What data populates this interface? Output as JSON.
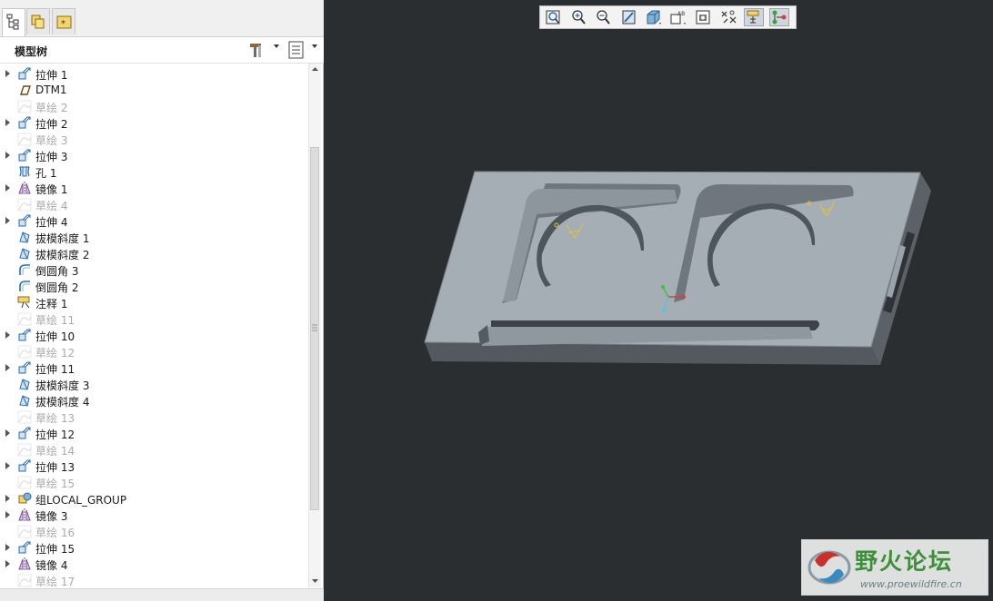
{
  "tabs": [
    {
      "icon": "model-tree-tab-icon"
    },
    {
      "icon": "folder-browser-tab-icon"
    },
    {
      "icon": "favorites-tab-icon"
    }
  ],
  "tree": {
    "title": "模型树",
    "header_buttons": [
      {
        "icon": "tree-settings-icon"
      },
      {
        "icon": "tree-columns-icon"
      }
    ],
    "items": [
      {
        "label": "拉伸 1",
        "icon": "extrude-icon",
        "expandable": true,
        "dim": false
      },
      {
        "label": "DTM1",
        "icon": "datum-plane-icon",
        "expandable": false,
        "dim": false
      },
      {
        "label": "草绘 2",
        "icon": "sketch-icon",
        "expandable": false,
        "dim": true
      },
      {
        "label": "拉伸 2",
        "icon": "extrude-icon",
        "expandable": true,
        "dim": false
      },
      {
        "label": "草绘 3",
        "icon": "sketch-icon",
        "expandable": false,
        "dim": true
      },
      {
        "label": "拉伸 3",
        "icon": "extrude-icon",
        "expandable": true,
        "dim": false
      },
      {
        "label": "孔 1",
        "icon": "hole-icon",
        "expandable": false,
        "dim": false
      },
      {
        "label": "镜像 1",
        "icon": "mirror-icon",
        "expandable": true,
        "dim": false
      },
      {
        "label": "草绘 4",
        "icon": "sketch-icon",
        "expandable": false,
        "dim": true
      },
      {
        "label": "拉伸 4",
        "icon": "extrude-icon",
        "expandable": true,
        "dim": false
      },
      {
        "label": "拔模斜度 1",
        "icon": "draft-icon",
        "expandable": false,
        "dim": false
      },
      {
        "label": "拔模斜度 2",
        "icon": "draft-icon",
        "expandable": false,
        "dim": false
      },
      {
        "label": "倒圆角 3",
        "icon": "round-icon",
        "expandable": false,
        "dim": false
      },
      {
        "label": "倒圆角 2",
        "icon": "round-icon",
        "expandable": false,
        "dim": false
      },
      {
        "label": "注释 1",
        "icon": "annotation-icon",
        "expandable": false,
        "dim": false
      },
      {
        "label": "草绘 11",
        "icon": "sketch-icon",
        "expandable": false,
        "dim": true
      },
      {
        "label": "拉伸 10",
        "icon": "extrude-icon",
        "expandable": true,
        "dim": false
      },
      {
        "label": "草绘 12",
        "icon": "sketch-icon",
        "expandable": false,
        "dim": true
      },
      {
        "label": "拉伸 11",
        "icon": "extrude-icon",
        "expandable": true,
        "dim": false
      },
      {
        "label": "拔模斜度 3",
        "icon": "draft-icon",
        "expandable": false,
        "dim": false
      },
      {
        "label": "拔模斜度 4",
        "icon": "draft-icon",
        "expandable": false,
        "dim": false
      },
      {
        "label": "草绘 13",
        "icon": "sketch-icon",
        "expandable": false,
        "dim": true
      },
      {
        "label": "拉伸 12",
        "icon": "extrude-icon",
        "expandable": true,
        "dim": false
      },
      {
        "label": "草绘 14",
        "icon": "sketch-icon",
        "expandable": false,
        "dim": true
      },
      {
        "label": "拉伸 13",
        "icon": "extrude-icon",
        "expandable": true,
        "dim": false
      },
      {
        "label": "草绘 15",
        "icon": "sketch-icon",
        "expandable": false,
        "dim": true
      },
      {
        "label": "组LOCAL_GROUP",
        "icon": "group-icon",
        "expandable": true,
        "dim": false
      },
      {
        "label": "镜像 3",
        "icon": "mirror-icon",
        "expandable": true,
        "dim": false
      },
      {
        "label": "草绘 16",
        "icon": "sketch-icon",
        "expandable": false,
        "dim": true
      },
      {
        "label": "拉伸 15",
        "icon": "extrude-icon",
        "expandable": true,
        "dim": false
      },
      {
        "label": "镜像 4",
        "icon": "mirror-icon",
        "expandable": true,
        "dim": false
      },
      {
        "label": "草绘 17",
        "icon": "sketch-icon",
        "expandable": false,
        "dim": true
      }
    ]
  },
  "toolbar": [
    {
      "icon": "refit-icon",
      "active": false
    },
    {
      "icon": "zoom-in-icon",
      "active": false
    },
    {
      "icon": "zoom-out-icon",
      "active": false
    },
    {
      "icon": "repaint-icon",
      "active": false
    },
    {
      "icon": "display-style-icon",
      "active": false
    },
    {
      "icon": "saved-orientations-icon",
      "active": false
    },
    {
      "icon": "view-manager-icon",
      "active": false
    },
    {
      "icon": "datum-display-icon",
      "active": false
    },
    {
      "icon": "annotation-display-icon",
      "active": true
    },
    {
      "icon": "spin-center-icon",
      "active": true
    }
  ],
  "viewport": {
    "background": "#2b2e30",
    "part_color": "#a5adb5",
    "annotation_color": "#e2c33c"
  },
  "watermark": {
    "title": "野火论坛",
    "url": "www.proewildfire.cn"
  }
}
